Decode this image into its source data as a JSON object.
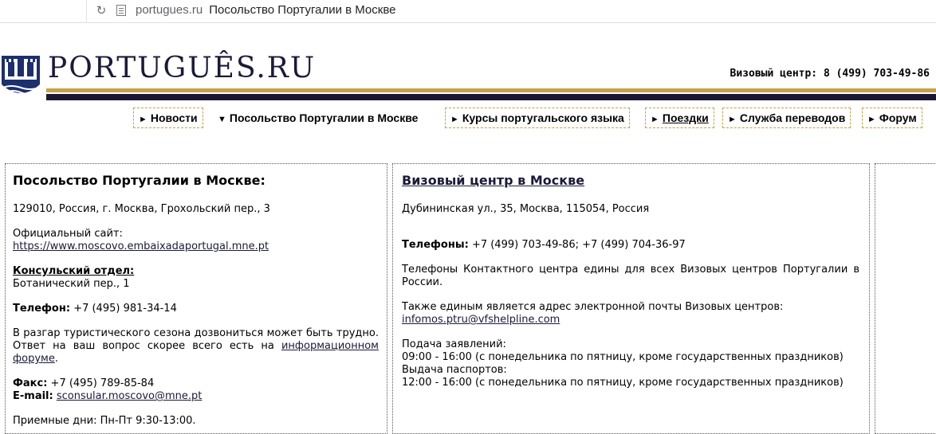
{
  "browser": {
    "url": "portugues.ru",
    "title": "Посольство Португалии в Москве"
  },
  "header": {
    "logo_text": "PORTUGUÊS.RU",
    "visa_phone": "Визовый центр: 8 (499) 703-49-86"
  },
  "nav": {
    "items": [
      {
        "label": "Новости",
        "arrow": "►"
      },
      {
        "label": "Посольство Португалии в Москве",
        "arrow": "▼"
      },
      {
        "label": "Курсы португальского языка",
        "arrow": "►"
      },
      {
        "label": "Поездки",
        "arrow": "►"
      },
      {
        "label": "Служба переводов",
        "arrow": "►"
      },
      {
        "label": "Форум",
        "arrow": "►"
      }
    ]
  },
  "embassy": {
    "title": "Посольство Португалии в Москве:",
    "address": "129010, Россия, г. Москва, Грохольский пер., 3",
    "site_label": "Официальный сайт:",
    "site_url": "https://www.moscovo.embaixadaportugal.mne.pt",
    "consular_label": "Консульский отдел:",
    "consular_address": "Ботанический пер., 1",
    "phone_label": "Телефон:",
    "phone": "+7 (495) 981-34-14",
    "note_text": "В разгар туристического сезона дозвониться может быть трудно. Ответ на ваш вопрос скорее всего есть на ",
    "note_link": "информационном форуме",
    "note_end": ".",
    "fax_label": "Факс:",
    "fax": "+7 (495) 789-85-84",
    "email_label": "E-mail:",
    "email": "sconsular.moscovo@mne.pt",
    "hours": "Приемные дни: Пн-Пт 9:30-13:00."
  },
  "visa_center": {
    "title": "Визовый центр в Москве",
    "address": "Дубининская ул., 35, Москва, 115054, Россия",
    "phones_label": "Телефоны:",
    "phones": "+7 (499) 703-49-86; +7 (499) 704-36-97",
    "contact_note": "Телефоны Контактного центра едины для всех Визовых центров Португалии в России.",
    "email_note": "Также единым является адрес электронной почты Визовых центров:",
    "email": "infomos.ptru@vfshelpline.com",
    "submit_label": "Подача заявлений:",
    "submit_hours": "09:00 - 16:00 (с понедельника по пятницу, кроме государственных праздников)",
    "pickup_label": "Выдача паспортов:",
    "pickup_hours": "12:00 - 16:00 (с понедельника по пятницу, кроме государственных праздников)"
  }
}
